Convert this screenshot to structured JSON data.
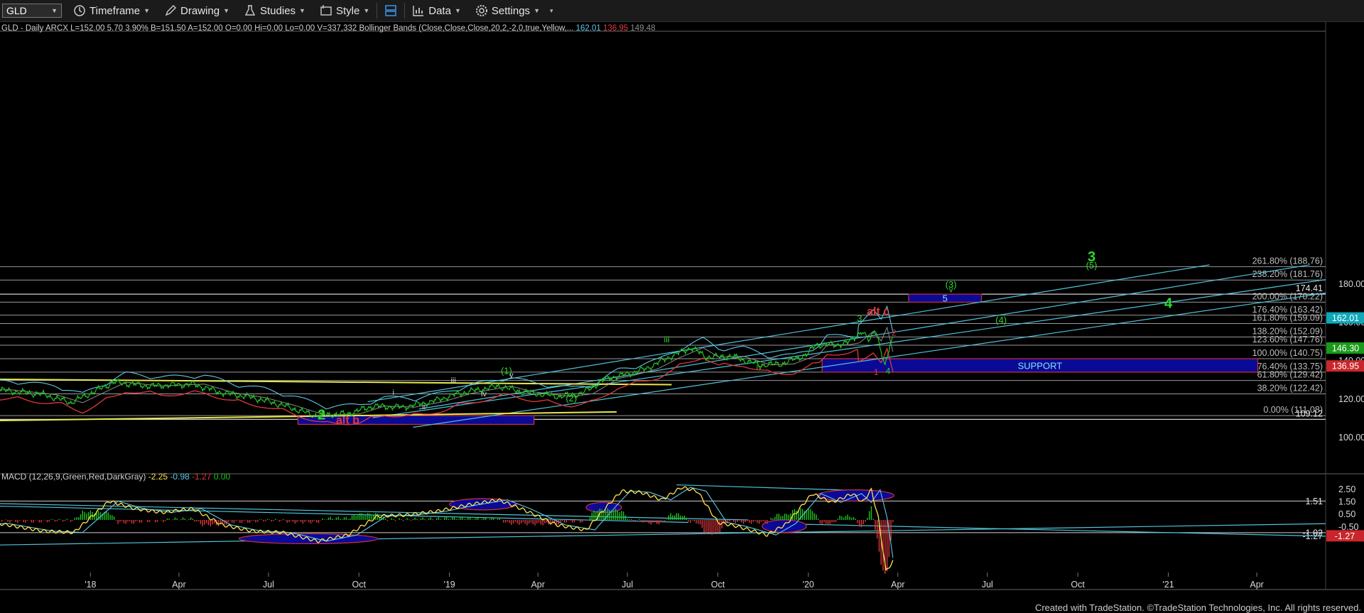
{
  "toolbar": {
    "symbol": "GLD",
    "timeframe": "Timeframe",
    "drawing": "Drawing",
    "studies": "Studies",
    "style": "Style",
    "data": "Data",
    "settings": "Settings"
  },
  "header": {
    "title": "GLD - Daily  ARCX  L=152.00  5.70  3.90%  B=151.50  A=152.00  O=0.00  Hi=0.00  Lo=0.00  V=337,332",
    "bb_label": "Bollinger Bands (Close,Close,Close,20,2,-2,0,true,Yellow,...",
    "bb_values": [
      "162.01",
      "136.95",
      "149.48"
    ],
    "bb_colors": [
      "#5fc8e8",
      "#e0383e",
      "#8c8c8c"
    ]
  },
  "macd_header": {
    "label": "MACD (12,26,9,Green,Red,DarkGray)",
    "values": [
      "-2.25",
      "-0.98",
      "-1.27",
      "0.00"
    ],
    "colors": [
      "#ffe34d",
      "#5fc8e8",
      "#e0383e",
      "#22c422"
    ]
  },
  "footer": {
    "credit": "Created with TradeStation. ©TradeStation Technologies, Inc. All rights reserved."
  },
  "colors": {
    "price": "#22c422",
    "bb_upper": "#5fc8e8",
    "bb_lower": "#e0383e",
    "bb_mid": "#8c8c8c",
    "channel": "#4fc3d9",
    "trendline": "#e8e84a",
    "box": "#0a0a96",
    "wave_green": "#2ed82e",
    "wave_red": "#e0383e",
    "fib": "#9a9a9a"
  },
  "chart_data": {
    "type": "line",
    "title": "GLD - Daily",
    "x_tick_labels": [
      "'18",
      "Apr",
      "Jul",
      "Oct",
      "'19",
      "Apr",
      "Jul",
      "Oct",
      "'20",
      "Apr",
      "Jul",
      "Oct",
      "'21",
      "Apr"
    ],
    "x_ticks": [
      "2018-01-01",
      "2018-04-01",
      "2018-07-01",
      "2018-10-01",
      "2019-01-01",
      "2019-04-01",
      "2019-07-01",
      "2019-10-01",
      "2020-01-01",
      "2020-04-01",
      "2020-07-01",
      "2020-10-01",
      "2021-01-01",
      "2021-04-01"
    ],
    "xlim": [
      "2017-10-01",
      "2021-06-10"
    ],
    "ylim": [
      95,
      192
    ],
    "y_ticks": [
      100,
      120,
      140,
      160,
      180
    ],
    "price_series": {
      "name": "GLD",
      "x": [
        "2017-10-01",
        "2017-11-15",
        "2017-12-12",
        "2018-01-25",
        "2018-03-01",
        "2018-04-15",
        "2018-05-15",
        "2018-06-15",
        "2018-07-15",
        "2018-08-16",
        "2018-09-20",
        "2018-10-15",
        "2018-11-15",
        "2018-12-15",
        "2019-01-10",
        "2019-02-20",
        "2019-03-15",
        "2019-04-23",
        "2019-05-15",
        "2019-06-10",
        "2019-06-25",
        "2019-07-20",
        "2019-08-10",
        "2019-09-04",
        "2019-09-20",
        "2019-10-15",
        "2019-11-12",
        "2019-12-05",
        "2019-12-31",
        "2020-01-08",
        "2020-01-30",
        "2020-02-10",
        "2020-02-24",
        "2020-03-03",
        "2020-03-09",
        "2020-03-19",
        "2020-03-24",
        "2020-03-27"
      ],
      "y": [
        124.5,
        122,
        117.8,
        128.5,
        126.5,
        127.5,
        123,
        120.5,
        116.5,
        111.3,
        112,
        116,
        115.5,
        118.5,
        122.5,
        126.5,
        123.5,
        121,
        122.5,
        130.5,
        132,
        135.5,
        141,
        146.5,
        141.5,
        142,
        137.5,
        138,
        143,
        148,
        148,
        149,
        155,
        150,
        157,
        136,
        148,
        152
      ]
    },
    "bollinger": {
      "upper_last": 162.01,
      "lower_last": 136.95,
      "mid_last": 149.48
    },
    "fib_levels": [
      {
        "label": "261.80% (188.76)",
        "value": 188.76
      },
      {
        "label": "238.20% (181.76)",
        "value": 181.76
      },
      {
        "label": "200.00% (170.22)",
        "value": 170.22
      },
      {
        "label": "176.40% (163.42)",
        "value": 163.42
      },
      {
        "label": "161.80% (159.09)",
        "value": 159.09
      },
      {
        "label": "138.20% (152.09)",
        "value": 152.09
      },
      {
        "label": "123.60% (147.76)",
        "value": 147.76
      },
      {
        "label": "100.00% (140.75)",
        "value": 140.75
      },
      {
        "label": "76.40% (133.75)",
        "value": 133.75
      },
      {
        "label": "61.80% (129.42)",
        "value": 129.42
      },
      {
        "label": "38.20% (122.42)",
        "value": 122.42
      },
      {
        "label": "0.00% (111.08)",
        "value": 111.08
      }
    ],
    "hlines": [
      {
        "label": "174.41",
        "value": 174.41
      },
      {
        "label": "109.12",
        "value": 109.12
      }
    ],
    "price_tags": [
      {
        "label": "162.01",
        "value": 162.01,
        "color": "#0ea8b8"
      },
      {
        "label": "146.30",
        "value": 146.3,
        "color": "#1a9a1a"
      },
      {
        "label": "136.95",
        "value": 136.95,
        "color": "#c8262c"
      }
    ],
    "boxes": [
      {
        "label": "SUPPORT",
        "x0": "2020-01-15",
        "x1": "2021-04-02",
        "y0": 133.75,
        "y1": 140.75
      },
      {
        "label": "5",
        "x0": "2020-04-12",
        "x1": "2020-06-25",
        "y0": 170.22,
        "y1": 174.41
      },
      {
        "label": "alt b",
        "x0": "2018-07-31",
        "x1": "2019-03-28",
        "y0": 106.5,
        "y1": 111.08
      }
    ],
    "channel_lines": [
      {
        "x": [
          "2018-10-10",
          "2021-02-12"
        ],
        "y": [
          118.3,
          189.7
        ]
      },
      {
        "x": [
          "2018-12-01",
          "2021-05-25"
        ],
        "y": [
          114.5,
          189.7
        ]
      },
      {
        "x": [
          "2018-10-15",
          "2021-06-10"
        ],
        "y": [
          110,
          182
        ]
      },
      {
        "x": [
          "2018-11-25",
          "2021-06-10"
        ],
        "y": [
          105,
          175
        ]
      }
    ],
    "trend_lines": [
      {
        "x": [
          "2017-10-01",
          "2019-08-15"
        ],
        "y": [
          130,
          127.2
        ]
      },
      {
        "x": [
          "2017-10-01",
          "2019-06-20"
        ],
        "y": [
          108.5,
          113
        ]
      }
    ],
    "annotations": [
      {
        "text": "3",
        "x": "2020-10-15",
        "y": 191.5,
        "color": "#2ed82e",
        "size": 20,
        "bold": true
      },
      {
        "text": "(5)",
        "x": "2020-10-15",
        "y": 187.7,
        "color": "#2ed82e",
        "size": 13
      },
      {
        "text": "(3)",
        "x": "2020-05-25",
        "y": 177.8,
        "color": "#2ed82e",
        "size": 13
      },
      {
        "text": "v",
        "x": "2020-05-25",
        "y": 175.3,
        "color": "#2ed82e",
        "size": 11
      },
      {
        "text": "4",
        "x": "2021-01-01",
        "y": 167.2,
        "color": "#2ed82e",
        "size": 20,
        "bold": true
      },
      {
        "text": "alt c",
        "x": "2020-03-12",
        "y": 163.5,
        "color": "#e0383e",
        "size": 16,
        "bold": true
      },
      {
        "text": "3",
        "x": "2020-02-22",
        "y": 160.2,
        "color": "#2ed82e",
        "size": 13
      },
      {
        "text": "(4)",
        "x": "2020-07-15",
        "y": 159.2,
        "color": "#2ed82e",
        "size": 13
      },
      {
        "text": "2",
        "x": "2020-03-28",
        "y": 152.7,
        "color": "#e0383e",
        "size": 12
      },
      {
        "text": "iii",
        "x": "2019-08-10",
        "y": 149.2,
        "color": "#2ed82e",
        "size": 12
      },
      {
        "text": "iv",
        "x": "2019-11-12",
        "y": 135.2,
        "color": "#2ed82e",
        "size": 11
      },
      {
        "text": "1",
        "x": "2020-03-10",
        "y": 132.2,
        "color": "#e0383e",
        "size": 12
      },
      {
        "text": "4",
        "x": "2020-03-22",
        "y": 132.8,
        "color": "#2ed82e",
        "size": 12
      },
      {
        "text": "(1)",
        "x": "2019-02-28",
        "y": 132.8,
        "color": "#2ed82e",
        "size": 13
      },
      {
        "text": "v",
        "x": "2019-03-05",
        "y": 131,
        "color": "#cfcfcf",
        "size": 11
      },
      {
        "text": "iii",
        "x": "2019-01-05",
        "y": 128.2,
        "color": "#cfcfcf",
        "size": 11
      },
      {
        "text": "iv",
        "x": "2019-02-05",
        "y": 121.2,
        "color": "#cfcfcf",
        "size": 11
      },
      {
        "text": "i",
        "x": "2018-11-05",
        "y": 121.8,
        "color": "#cfcfcf",
        "size": 11
      },
      {
        "text": "ii",
        "x": "2018-12-06",
        "y": 114.5,
        "color": "#cfcfcf",
        "size": 11
      },
      {
        "text": "(2)",
        "x": "2019-05-05",
        "y": 118.5,
        "color": "#2ed82e",
        "size": 13
      },
      {
        "text": "2",
        "x": "2018-08-24",
        "y": 109,
        "color": "#2ed82e",
        "size": 20,
        "bold": true
      }
    ],
    "macd": {
      "ylim": [
        -4.2,
        3.4
      ],
      "y_ticks": [
        2.5,
        1.5,
        0.5,
        -0.5
      ],
      "tags": [
        {
          "label": "1.51",
          "value": 1.51
        },
        {
          "label": "-1.02",
          "value": -1.02
        },
        {
          "label": "-1.27",
          "value": -1.27
        }
      ],
      "hlines": [
        1.51,
        -1.02
      ],
      "macd_line": {
        "x": [
          "2017-10-01",
          "2017-11-15",
          "2017-12-15",
          "2018-01-20",
          "2018-02-15",
          "2018-03-15",
          "2018-04-15",
          "2018-05-15",
          "2018-06-15",
          "2018-07-15",
          "2018-08-20",
          "2018-09-20",
          "2018-10-20",
          "2018-11-20",
          "2018-12-20",
          "2019-01-20",
          "2019-02-20",
          "2019-03-15",
          "2019-04-20",
          "2019-05-20",
          "2019-06-15",
          "2019-06-25",
          "2019-07-15",
          "2019-08-05",
          "2019-08-25",
          "2019-09-10",
          "2019-10-01",
          "2019-10-20",
          "2019-11-20",
          "2019-12-10",
          "2020-01-05",
          "2020-01-25",
          "2020-02-15",
          "2020-02-25",
          "2020-03-05",
          "2020-03-12",
          "2020-03-20",
          "2020-03-27"
        ],
        "y": [
          -0.3,
          -0.9,
          -1.0,
          1.5,
          0.9,
          0.6,
          0.9,
          -0.4,
          -0.9,
          -1.0,
          -1.7,
          -1.2,
          0.3,
          0.4,
          0.7,
          1.2,
          1.6,
          0.9,
          -0.4,
          -0.8,
          1.5,
          2.3,
          2.2,
          1.6,
          2.6,
          2.3,
          -0.2,
          -0.5,
          -1.2,
          -0.3,
          2.1,
          1.4,
          2.1,
          1.4,
          2.4,
          0.2,
          -4.1,
          -3.3
        ]
      },
      "histogram_style": "green bars above zero, red below"
    },
    "macd_ellipses": [
      {
        "x0": "2018-06-01",
        "x1": "2018-10-20",
        "y0": -1.9,
        "y1": -1.1
      },
      {
        "x0": "2019-01-01",
        "x1": "2019-03-10",
        "y0": 0.8,
        "y1": 1.7
      },
      {
        "x0": "2019-05-20",
        "x1": "2019-06-25",
        "y0": 0.6,
        "y1": 1.4
      },
      {
        "x0": "2019-11-15",
        "x1": "2019-12-30",
        "y0": -1.0,
        "y1": 0
      },
      {
        "x0": "2020-01-10",
        "x1": "2020-03-28",
        "y0": 1.5,
        "y1": 2.4
      }
    ]
  }
}
